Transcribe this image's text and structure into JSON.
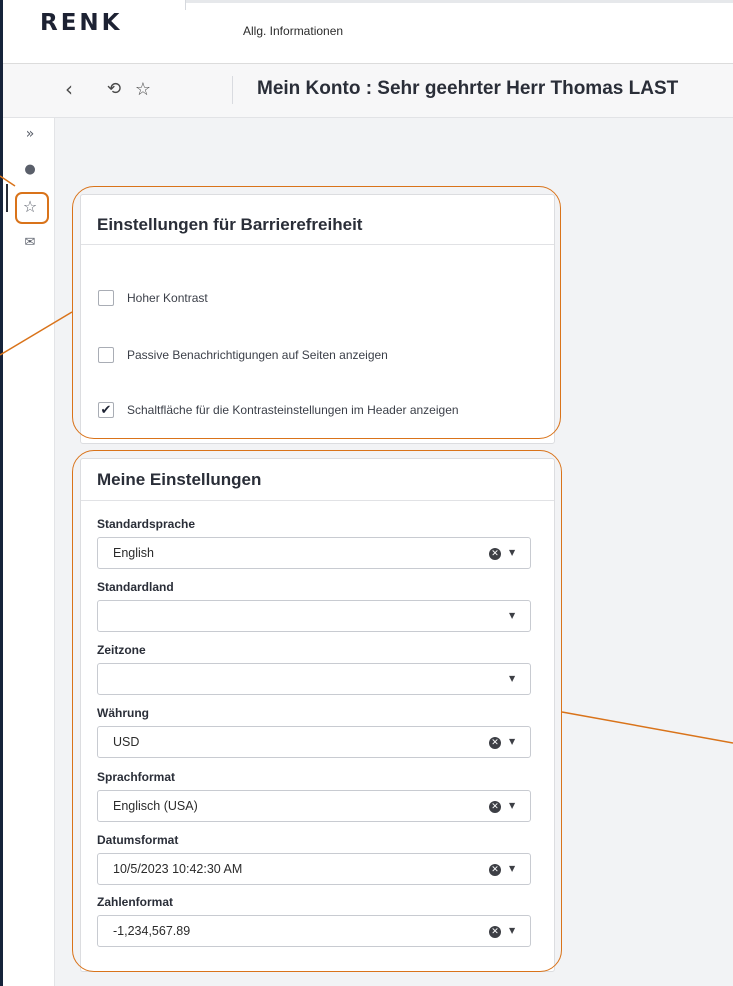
{
  "header": {
    "logo": "RENK",
    "nav_item": "Allg. Informationen"
  },
  "toolbar": {
    "back_icon": "chevron-left-icon",
    "history_icon": "history-icon",
    "favorite_icon": "star-icon",
    "title": "Mein Konto : Sehr geehrter Herr Thomas LAST"
  },
  "sidebar": {
    "items": [
      {
        "name": "expand-icon",
        "glyph": "»"
      },
      {
        "name": "user-icon",
        "glyph": "●"
      },
      {
        "name": "star-icon",
        "glyph": "☆"
      },
      {
        "name": "mail-icon",
        "glyph": "✉"
      }
    ]
  },
  "accessibility": {
    "title": "Einstellungen für Barrierefreiheit",
    "options": [
      {
        "label": "Hoher Kontrast",
        "checked": false
      },
      {
        "label": "Passive Benachrichtigungen auf Seiten anzeigen",
        "checked": false
      },
      {
        "label": "Schaltfläche für die Kontrasteinstellungen im Header anzeigen",
        "checked": true
      }
    ]
  },
  "settings": {
    "title": "Meine Einstellungen",
    "fields": [
      {
        "label": "Standardsprache",
        "value": "English",
        "clearable": true
      },
      {
        "label": "Standardland",
        "value": "",
        "clearable": false
      },
      {
        "label": "Zeitzone",
        "value": "",
        "clearable": false
      },
      {
        "label": "Währung",
        "value": "USD",
        "clearable": true
      },
      {
        "label": "Sprachformat",
        "value": "Englisch (USA)",
        "clearable": true
      },
      {
        "label": "Datumsformat",
        "value": "10/5/2023 10:42:30 AM",
        "clearable": true
      },
      {
        "label": "Zahlenformat",
        "value": "-1,234,567.89",
        "clearable": true
      }
    ]
  },
  "colors": {
    "annotation": "#d9731a",
    "background_dark": "#16233a"
  }
}
